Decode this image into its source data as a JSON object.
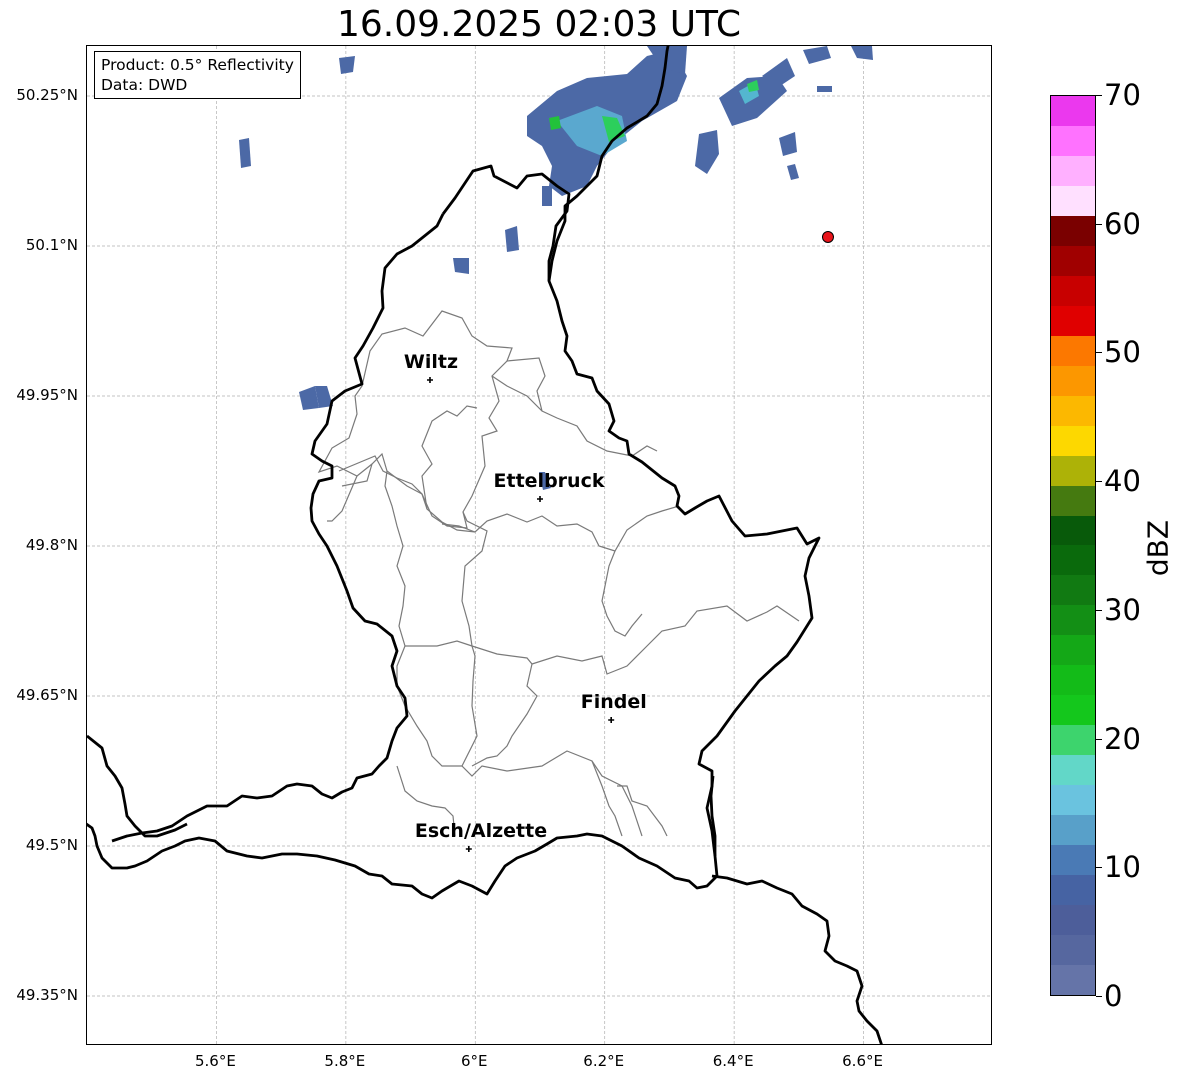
{
  "title": "16.09.2025 02:03 UTC",
  "infobox": {
    "product": "Product: 0.5° Reflectivity",
    "data_source": "Data: DWD"
  },
  "axes": {
    "lon_range": [
      5.4,
      6.8
    ],
    "lat_range": [
      49.3,
      50.3
    ],
    "lat_ticks": [
      {
        "value": 50.25,
        "label": "50.25°N"
      },
      {
        "value": 50.1,
        "label": "50.1°N"
      },
      {
        "value": 49.95,
        "label": "49.95°N"
      },
      {
        "value": 49.8,
        "label": "49.8°N"
      },
      {
        "value": 49.65,
        "label": "49.65°N"
      },
      {
        "value": 49.5,
        "label": "49.5°N"
      },
      {
        "value": 49.35,
        "label": "49.35°N"
      }
    ],
    "lon_ticks": [
      {
        "value": 5.6,
        "label": "5.6°E"
      },
      {
        "value": 5.8,
        "label": "5.8°E"
      },
      {
        "value": 6.0,
        "label": "6°E"
      },
      {
        "value": 6.2,
        "label": "6.2°E"
      },
      {
        "value": 6.4,
        "label": "6.4°E"
      },
      {
        "value": 6.6,
        "label": "6.6°E"
      }
    ],
    "grid": true
  },
  "cities": [
    {
      "name": "Wiltz",
      "lon": 5.93,
      "lat": 49.966
    },
    {
      "name": "Ettelbruck",
      "lon": 6.1,
      "lat": 49.847
    },
    {
      "name": "Findel",
      "lon": 6.21,
      "lat": 49.626
    },
    {
      "name": "Esch/Alzette",
      "lon": 5.99,
      "lat": 49.497
    }
  ],
  "marker": {
    "lon": 6.545,
    "lat": 50.109,
    "color": "#e8141b"
  },
  "colorbar": {
    "unit": "dBZ",
    "min": 0,
    "max": 70,
    "step": 2.5,
    "tick_labels": [
      "0",
      "10",
      "20",
      "30",
      "40",
      "50",
      "60",
      "70"
    ],
    "colors": [
      "#6574a8",
      "#56679f",
      "#4d5e9a",
      "#4663a3",
      "#4a7ab5",
      "#58a0c9",
      "#6ac3df",
      "#62d7c8",
      "#3dd46d",
      "#14c71c",
      "#13bb18",
      "#14a817",
      "#138f15",
      "#117a12",
      "#0a6a0c",
      "#085a0a",
      "#457a10",
      "#adb207",
      "#fdd800",
      "#fcb800",
      "#fc9700",
      "#fc7800",
      "#e00000",
      "#c80000",
      "#a00000",
      "#7a0000",
      "#ffe0ff",
      "#ffb0ff",
      "#ff72ff",
      "#eb38ee"
    ]
  }
}
